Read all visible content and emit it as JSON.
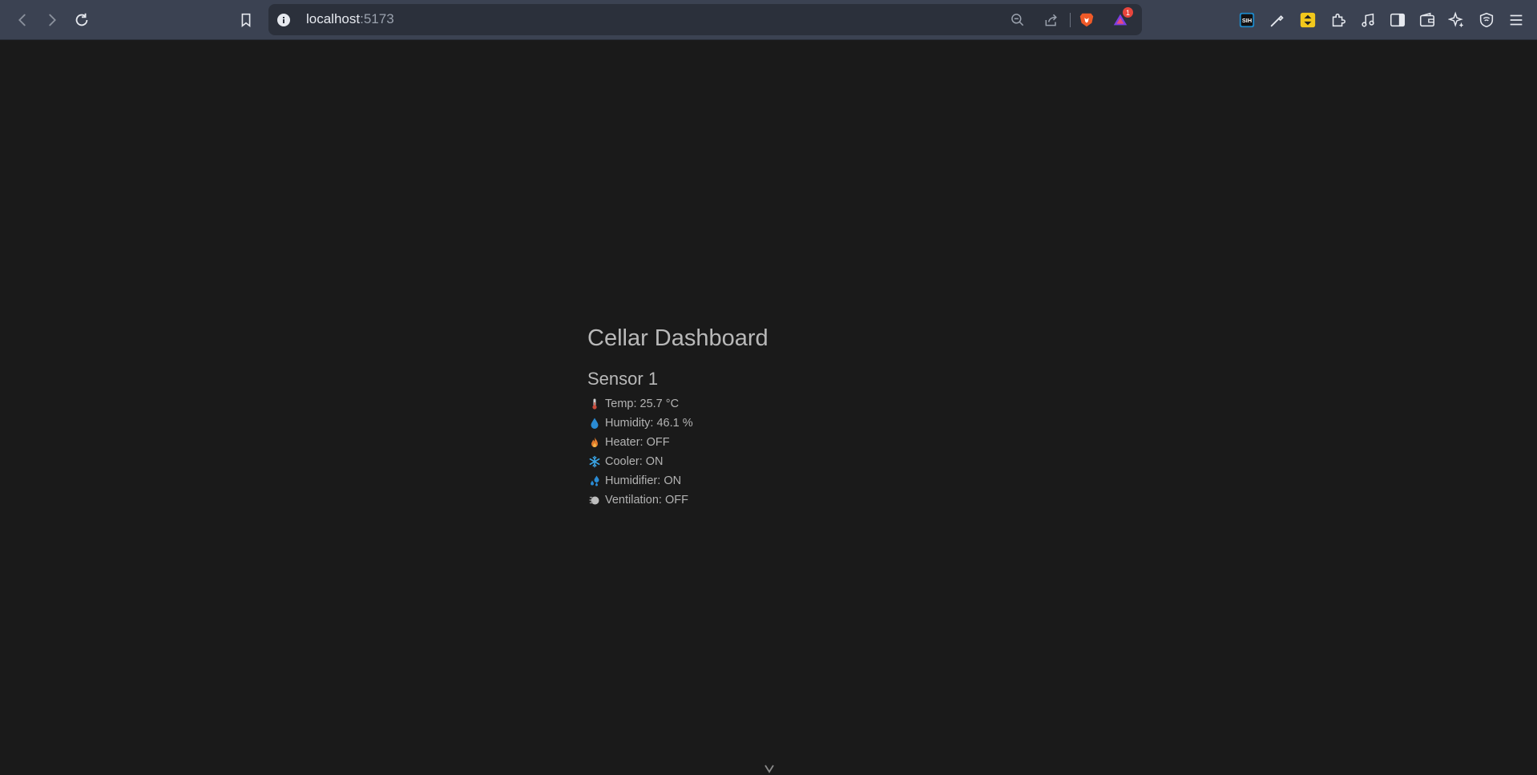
{
  "browser": {
    "url_host": "localhost",
    "url_port": ":5173",
    "notification_count": "1"
  },
  "page": {
    "title": "Cellar Dashboard",
    "sensor": {
      "name": "Sensor 1",
      "readings": [
        {
          "icon": "thermometer-icon",
          "text": "Temp: 25.7 °C"
        },
        {
          "icon": "water-drop-icon",
          "text": "Humidity: 46.1 %"
        },
        {
          "icon": "flame-icon",
          "text": "Heater: OFF"
        },
        {
          "icon": "snowflake-icon",
          "text": "Cooler: ON"
        },
        {
          "icon": "humidifier-drops-icon",
          "text": "Humidifier: ON"
        },
        {
          "icon": "fan-icon",
          "text": "Ventilation: OFF"
        }
      ]
    }
  },
  "colors": {
    "background": "#1a1a1a",
    "toolbar": "#3b4252",
    "urlbar": "#2b303b",
    "accent_blue": "#2a8bd4",
    "accent_orange": "#e07a2c"
  }
}
